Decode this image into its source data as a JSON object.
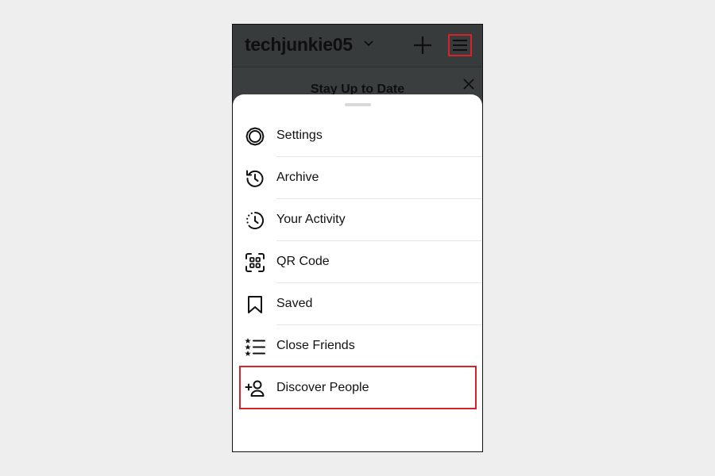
{
  "header": {
    "username": "techjunkie05",
    "banner_title": "Stay Up to Date"
  },
  "menu": {
    "items": [
      {
        "label": "Settings",
        "icon": "settings-icon"
      },
      {
        "label": "Archive",
        "icon": "archive-icon"
      },
      {
        "label": "Your Activity",
        "icon": "activity-icon"
      },
      {
        "label": "QR Code",
        "icon": "qr-code-icon"
      },
      {
        "label": "Saved",
        "icon": "bookmark-icon"
      },
      {
        "label": "Close Friends",
        "icon": "close-friends-icon"
      },
      {
        "label": "Discover People",
        "icon": "add-person-icon"
      }
    ]
  },
  "colors": {
    "highlight": "#d6232a",
    "overlay": "#373b3c",
    "background": "#efeeee"
  }
}
